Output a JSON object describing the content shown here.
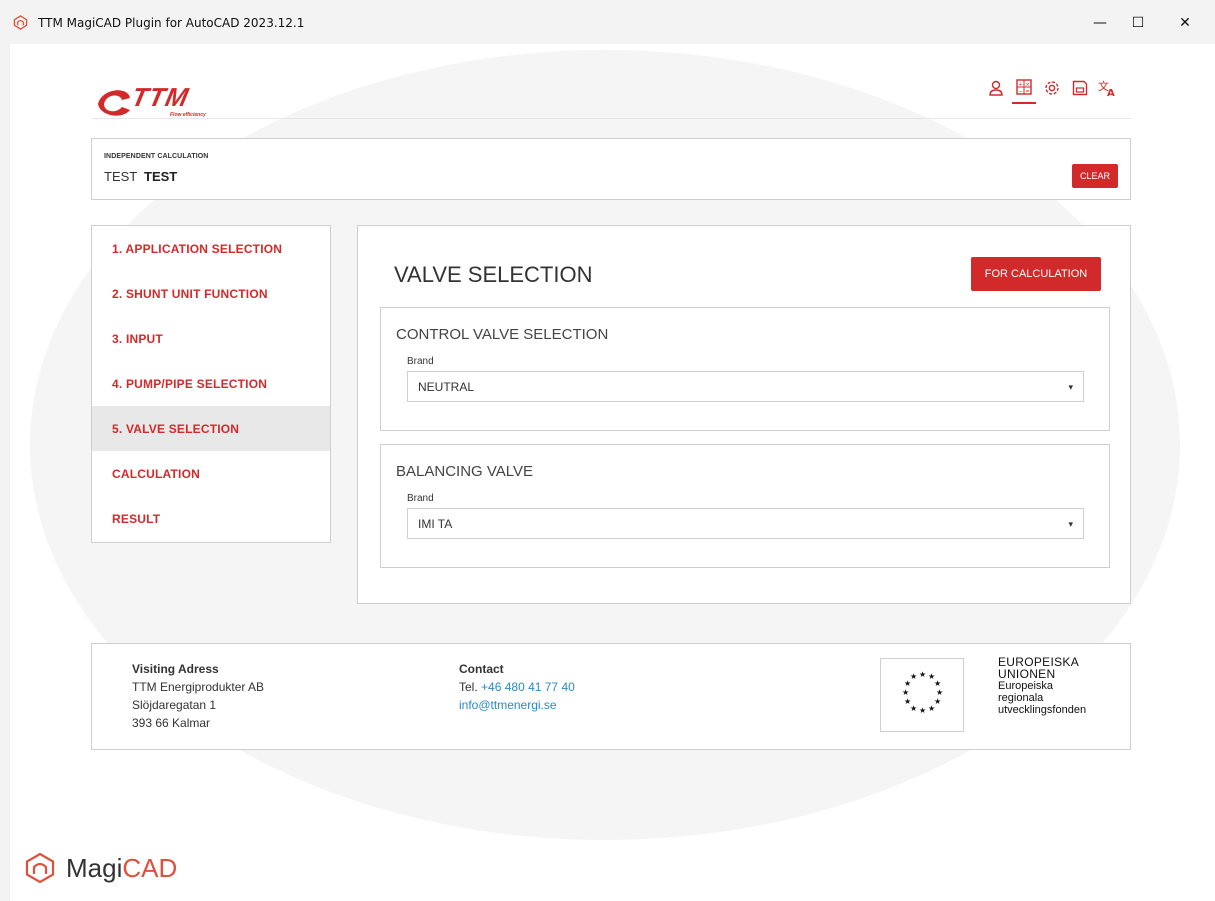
{
  "window": {
    "title": "TTM MagiCAD Plugin for AutoCAD 2023.12.1",
    "minimize_glyph": "—",
    "maximize_glyph": "☐",
    "close_glyph": "✕"
  },
  "header": {
    "logo_text": "TTM",
    "logo_tagline": "Flow efficiency",
    "icons": [
      "user-icon",
      "calculator-icon",
      "gear-icon",
      "save-icon",
      "translate-icon"
    ],
    "active_icon": "calculator-icon"
  },
  "calculation": {
    "label": "INDEPENDENT CALCULATION",
    "name_prefix": "TEST",
    "name": "TEST",
    "clear_label": "CLEAR"
  },
  "nav": {
    "items": [
      {
        "label": "1. APPLICATION SELECTION",
        "active": false
      },
      {
        "label": "2. SHUNT UNIT FUNCTION",
        "active": false
      },
      {
        "label": "3. INPUT",
        "active": false
      },
      {
        "label": "4. PUMP/PIPE SELECTION",
        "active": false
      },
      {
        "label": "5. VALVE SELECTION",
        "active": true
      },
      {
        "label": "CALCULATION",
        "active": false
      },
      {
        "label": "RESULT",
        "active": false
      }
    ]
  },
  "main": {
    "title": "VALVE SELECTION",
    "for_calculation_label": "FOR CALCULATION",
    "control_valve": {
      "title": "CONTROL VALVE SELECTION",
      "brand_label": "Brand",
      "brand_value": "NEUTRAL"
    },
    "balancing_valve": {
      "title": "BALANCING VALVE",
      "brand_label": "Brand",
      "brand_value": "IMI TA"
    },
    "caret": "▾"
  },
  "footer": {
    "visiting": {
      "heading": "Visiting Adress",
      "line1": "TTM Energiprodukter AB",
      "line2": "Slöjdaregatan 1",
      "line3": "393 66 Kalmar"
    },
    "contact": {
      "heading": "Contact",
      "tel_prefix": "Tel.",
      "tel": "+46 480 41 77 40",
      "email": "info@ttmenergi.se"
    },
    "eu": {
      "line1": "EUROPEISKA",
      "line2": "UNIONEN",
      "line3": "Europeiska",
      "line4": "regionala",
      "line5": "utvecklingsfonden"
    }
  },
  "magicad": {
    "text_magi": "Magi",
    "text_cad": "CAD"
  },
  "colors": {
    "brand_red": "#d22a2a",
    "link_blue": "#2a8ac4",
    "nav_active_bg": "#e8e8e8"
  }
}
